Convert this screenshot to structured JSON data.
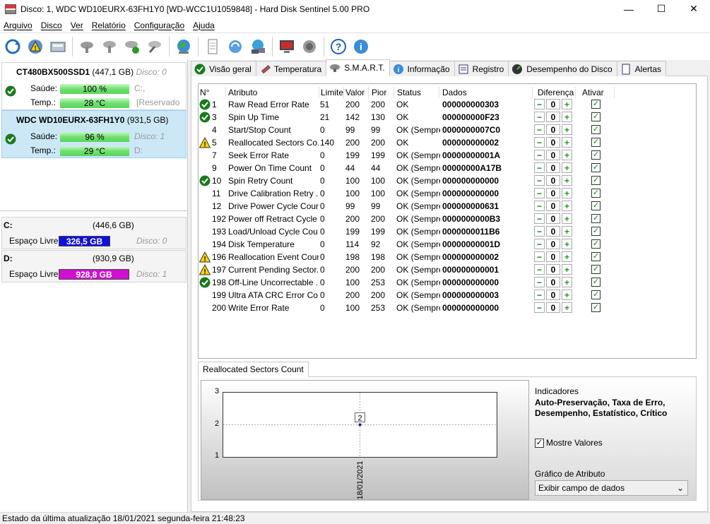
{
  "window": {
    "title": "Disco: 1, WDC WD10EURX-63FH1Y0 [WD-WCC1U1059848]  -  Hard Disk Sentinel 5.00 PRO",
    "minimize": "—",
    "maximize": "☐",
    "close": "✕"
  },
  "menu": [
    "Arquivo",
    "Disco",
    "Ver",
    "Relatório",
    "Configuração",
    "Ajuda"
  ],
  "disks": [
    {
      "name": "CT480BX500SSD1",
      "capacity": "(447,1 GB)",
      "disk_label": "Disco: 0",
      "health_label": "Saúde:",
      "health": "100 %",
      "temp_label": "Temp.:",
      "temp": "28 °C",
      "vol1": "C:,",
      "vol2": "[Reservado p"
    },
    {
      "name": "WDC WD10EURX-63FH1Y0",
      "capacity": "(931,5 GB)",
      "disk_label": "",
      "health_label": "Saúde:",
      "health": "96 %",
      "temp_label": "Temp.:",
      "temp": "29 °C",
      "vol1": "Disco: 1",
      "vol2": "D:"
    }
  ],
  "volumes": [
    {
      "letter": "C:",
      "size": "(446,6 GB)",
      "free_label": "Espaço Livre",
      "free": "326,5 GB",
      "free_pct": 0.731,
      "disk": "Disco: 0",
      "color": "#1010e0"
    },
    {
      "letter": "D:",
      "size": "(930,9 GB)",
      "free_label": "Espaço Livre",
      "free": "928,8 GB",
      "free_pct": 0.998,
      "disk": "Disco: 1",
      "color": "#d010d0"
    }
  ],
  "tabs": [
    "Visão geral",
    "Temperatura",
    "S.M.A.R.T.",
    "Informação",
    "Registro",
    "Desempenho do Disco",
    "Alertas"
  ],
  "smart": {
    "headers": {
      "num": "N°",
      "attr": "Atributo",
      "limit": "Limite",
      "value": "Valor",
      "worst": "Pior",
      "status": "Status",
      "data": "Dados",
      "diff": "Diferença",
      "enable": "Ativar"
    },
    "rows": [
      {
        "icon": "ok",
        "num": "1",
        "attr": "Raw Read Error Rate",
        "limit": "51",
        "value": "200",
        "worst": "200",
        "status": "OK",
        "data": "000000000303",
        "diff": "0"
      },
      {
        "icon": "ok",
        "num": "3",
        "attr": "Spin Up Time",
        "limit": "21",
        "value": "142",
        "worst": "130",
        "status": "OK",
        "data": "000000000F23",
        "diff": "0"
      },
      {
        "icon": "",
        "num": "4",
        "attr": "Start/Stop Count",
        "limit": "0",
        "value": "99",
        "worst": "99",
        "status": "OK (Sempre...",
        "data": "0000000007C0",
        "diff": "0"
      },
      {
        "icon": "warn",
        "num": "5",
        "attr": "Reallocated Sectors Co...",
        "limit": "140",
        "value": "200",
        "worst": "200",
        "status": "OK",
        "data": "000000000002",
        "diff": "0"
      },
      {
        "icon": "",
        "num": "7",
        "attr": "Seek Error Rate",
        "limit": "0",
        "value": "199",
        "worst": "199",
        "status": "OK (Sempre...",
        "data": "00000000001A",
        "diff": "0"
      },
      {
        "icon": "",
        "num": "9",
        "attr": "Power On Time Count",
        "limit": "0",
        "value": "44",
        "worst": "44",
        "status": "OK (Sempre...",
        "data": "00000000A17B",
        "diff": "0"
      },
      {
        "icon": "ok",
        "num": "10",
        "attr": "Spin Retry Count",
        "limit": "0",
        "value": "100",
        "worst": "100",
        "status": "OK (Sempre...",
        "data": "000000000000",
        "diff": "0"
      },
      {
        "icon": "",
        "num": "11",
        "attr": "Drive Calibration Retry ...",
        "limit": "0",
        "value": "100",
        "worst": "100",
        "status": "OK (Sempre...",
        "data": "000000000000",
        "diff": "0"
      },
      {
        "icon": "",
        "num": "12",
        "attr": "Drive Power Cycle Count",
        "limit": "0",
        "value": "99",
        "worst": "99",
        "status": "OK (Sempre...",
        "data": "000000000631",
        "diff": "0"
      },
      {
        "icon": "",
        "num": "192",
        "attr": "Power off Retract Cycle ...",
        "limit": "0",
        "value": "200",
        "worst": "200",
        "status": "OK (Sempre...",
        "data": "0000000000B3",
        "diff": "0"
      },
      {
        "icon": "",
        "num": "193",
        "attr": "Load/Unload Cycle Cou...",
        "limit": "0",
        "value": "199",
        "worst": "199",
        "status": "OK (Sempre...",
        "data": "0000000011B6",
        "diff": "0"
      },
      {
        "icon": "",
        "num": "194",
        "attr": "Disk Temperature",
        "limit": "0",
        "value": "114",
        "worst": "92",
        "status": "OK (Sempre...",
        "data": "00000000001D",
        "diff": "0"
      },
      {
        "icon": "warn",
        "num": "196",
        "attr": "Reallocation Event Count",
        "limit": "0",
        "value": "198",
        "worst": "198",
        "status": "OK (Sempre...",
        "data": "000000000002",
        "diff": "0"
      },
      {
        "icon": "warn",
        "num": "197",
        "attr": "Current Pending Sector...",
        "limit": "0",
        "value": "200",
        "worst": "200",
        "status": "OK (Sempre...",
        "data": "000000000001",
        "diff": "0"
      },
      {
        "icon": "ok",
        "num": "198",
        "attr": "Off-Line Uncorrectable ...",
        "limit": "0",
        "value": "100",
        "worst": "253",
        "status": "OK (Sempre...",
        "data": "000000000000",
        "diff": "0"
      },
      {
        "icon": "",
        "num": "199",
        "attr": "Ultra ATA CRC Error Co...",
        "limit": "0",
        "value": "200",
        "worst": "200",
        "status": "OK (Sempre...",
        "data": "000000000003",
        "diff": "0"
      },
      {
        "icon": "",
        "num": "200",
        "attr": "Write Error Rate",
        "limit": "0",
        "value": "100",
        "worst": "253",
        "status": "OK (Sempre...",
        "data": "000000000000",
        "diff": "0"
      }
    ]
  },
  "graph": {
    "tab": "Reallocated Sectors Count",
    "indicators_title": "Indicadores",
    "indicators_text": "Auto-Preservação, Taxa de Erro, Desempenho, Estatístico, Crítico",
    "show_values_label": "Mostre Valores",
    "attr_graph_label": "Gráfico de Atributo",
    "dropdown_value": "Exibir campo de dados"
  },
  "chart_data": {
    "type": "scatter",
    "x": [
      "18/01/2021"
    ],
    "values": [
      2
    ],
    "data_labels": [
      "2"
    ],
    "ylim": [
      1,
      3
    ],
    "yticks": [
      "3",
      "2",
      "1"
    ]
  },
  "status": "Estado da última atualização 18/01/2021 segunda-feira 21:48:23"
}
